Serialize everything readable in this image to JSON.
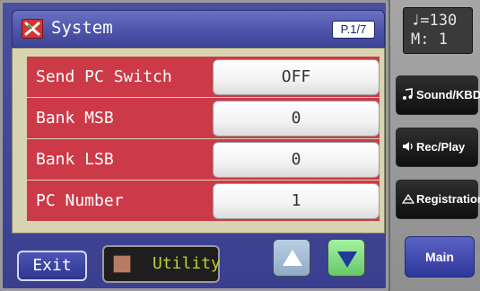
{
  "window": {
    "title": "System",
    "page": "P.1/7"
  },
  "rows": [
    {
      "label": "Send PC Switch",
      "value": "OFF"
    },
    {
      "label": "Bank MSB",
      "value": "0"
    },
    {
      "label": "Bank LSB",
      "value": "0"
    },
    {
      "label": "PC Number",
      "value": "1"
    }
  ],
  "bottom": {
    "exit_label": "Exit",
    "utility_label": "Utility"
  },
  "side": {
    "tempo_line1": "♩=130",
    "tempo_line2": "M:  1",
    "buttons": [
      {
        "label": "Sound/KBD",
        "icon": "music-note-icon"
      },
      {
        "label": "Rec/Play",
        "icon": "speaker-icon"
      },
      {
        "label": "Registration",
        "icon": "registration-icon"
      }
    ],
    "main_label": "Main"
  },
  "colors": {
    "accent": "#3e4596",
    "row_label_bg": "#cc3a48",
    "up": "#a8c0d8",
    "down": "#7ad47a"
  }
}
